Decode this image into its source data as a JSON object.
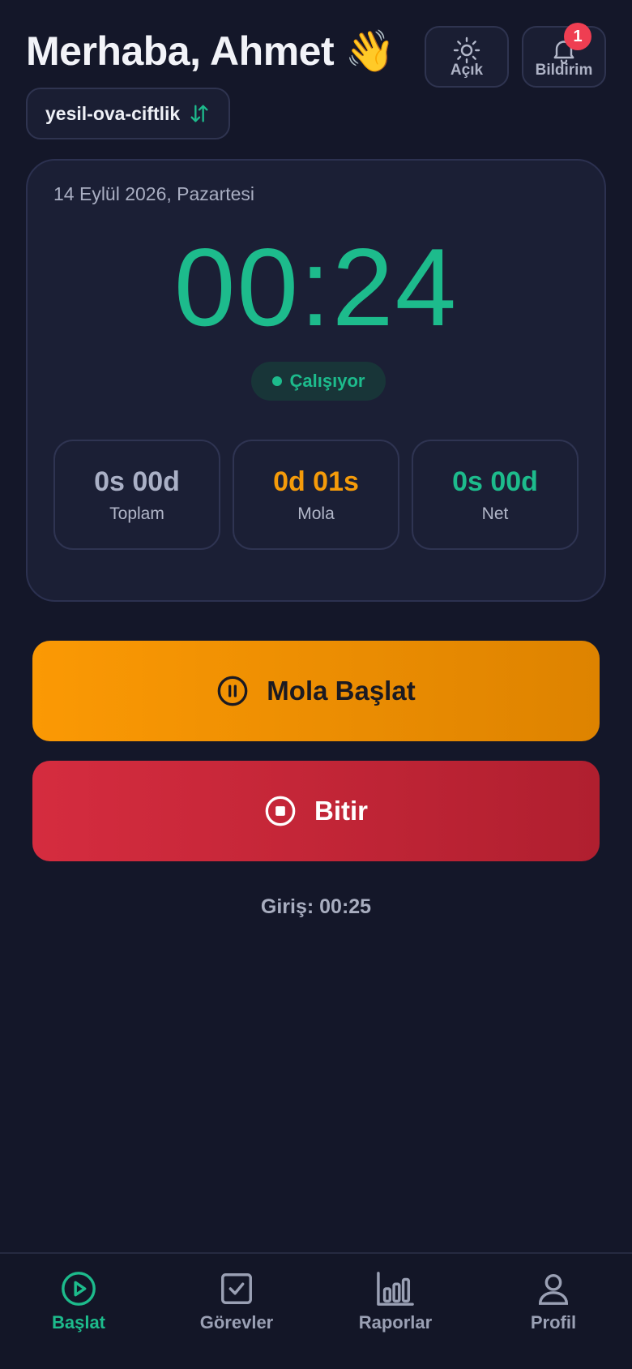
{
  "header": {
    "greeting": "Merhaba, Ahmet 👋",
    "theme_label": "Açık",
    "notifications_label": "Bildirim",
    "notifications_count": "1"
  },
  "farm": {
    "name": "yesil-ova-ciftlik",
    "switch_icon": "swap-vertical-icon"
  },
  "timer_card": {
    "date": "14 Eylül 2026, Pazartesi",
    "time": "00:24",
    "status": "Çalışıyor",
    "stats": [
      {
        "value": "0s 00d",
        "label": "Toplam"
      },
      {
        "value": "0d 01s",
        "label": "Mola"
      },
      {
        "value": "0s 00d",
        "label": "Net"
      }
    ]
  },
  "actions": {
    "pause_label": "Mola Başlat",
    "stop_label": "Bitir"
  },
  "entry_text": "Giriş: 00:25",
  "nav": {
    "items": [
      {
        "label": "Başlat",
        "icon": "play-circle-icon",
        "active": true
      },
      {
        "label": "Görevler",
        "icon": "checkbox-icon",
        "active": false
      },
      {
        "label": "Raporlar",
        "icon": "bar-chart-icon",
        "active": false
      },
      {
        "label": "Profil",
        "icon": "user-icon",
        "active": false
      }
    ]
  },
  "colors": {
    "background": "#141729",
    "accent_green": "#1dbb8c",
    "accent_orange": "#f59b0a",
    "danger_red": "#d52c3f",
    "badge_red": "#ef3e52"
  }
}
